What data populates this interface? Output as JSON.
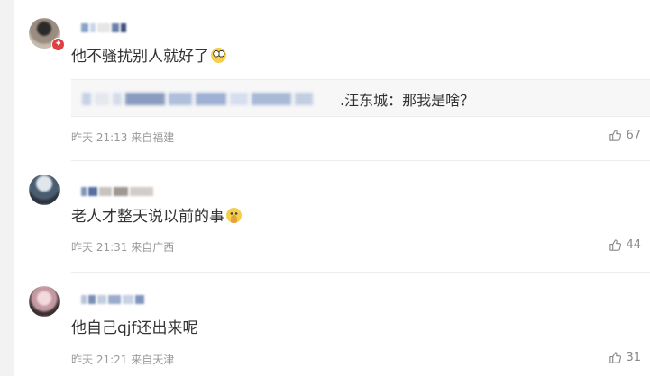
{
  "comments": [
    {
      "text": "他不骚扰别人就好了",
      "emoji": "shocked-face-icon",
      "quote": ".汪东城：那我是啥？",
      "time": "昨天 21:13 来自福建",
      "likes": "67"
    },
    {
      "text": "老人才整天说以前的事",
      "emoji": "hand-over-mouth-face-icon",
      "time": "昨天 21:31 来自广西",
      "likes": "44"
    },
    {
      "text": "他自己qjf还出来呢",
      "time": "昨天 21:21 来自天津",
      "likes": "31"
    }
  ],
  "colors": {
    "text": "#333333",
    "meta": "#999999",
    "badge": "#e04040",
    "divider": "#ececec"
  }
}
